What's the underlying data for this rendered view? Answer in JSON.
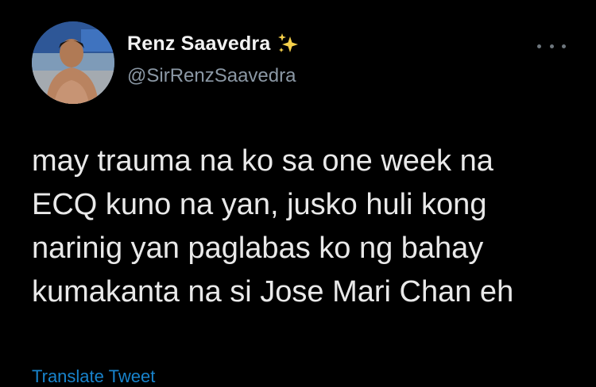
{
  "user": {
    "display_name": "Renz Saavedra",
    "handle": "@SirRenzSaavedra",
    "badge_icon": "sparkles-icon",
    "avatar_icon": "profile-photo"
  },
  "menu": {
    "icon": "more-options-icon"
  },
  "tweet": {
    "lines": [
      "may trauma na ko sa one week na",
      "ECQ kuno na yan, jusko huli kong",
      "narinig yan paglabas ko ng bahay",
      "kumakanta na si Jose Mari Chan eh"
    ]
  },
  "footer": {
    "translate_label": "Translate Tweet"
  },
  "colors": {
    "background": "#000000",
    "name": "#f2f2f2",
    "handle": "#8b98a5",
    "body": "#e9e9e9",
    "link": "#1d9bf0",
    "sparkle": "#f5d04a"
  }
}
